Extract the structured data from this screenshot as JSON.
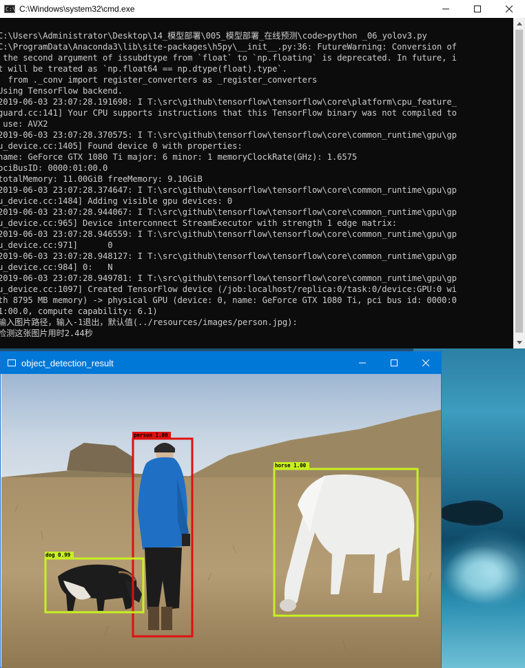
{
  "cmd_window": {
    "title": "C:\\Windows\\system32\\cmd.exe",
    "icon": "C:\\",
    "lines": [
      "C:\\Users\\Administrator\\Desktop\\14_模型部署\\005_模型部署_在线预测\\code>python _06_yolov3.py",
      "C:\\ProgramData\\Anaconda3\\lib\\site-packages\\h5py\\__init__.py:36: FutureWarning: Conversion of",
      " the second argument of issubdtype from `float` to `np.floating` is deprecated. In future, i",
      "t will be treated as `np.float64 == np.dtype(float).type`.",
      "  from ._conv import register_converters as _register_converters",
      "Using TensorFlow backend.",
      "2019-06-03 23:07:28.191698: I T:\\src\\github\\tensorflow\\tensorflow\\core\\platform\\cpu_feature_",
      "guard.cc:141] Your CPU supports instructions that this TensorFlow binary was not compiled to",
      " use: AVX2",
      "2019-06-03 23:07:28.370575: I T:\\src\\github\\tensorflow\\tensorflow\\core\\common_runtime\\gpu\\gp",
      "u_device.cc:1405] Found device 0 with properties:",
      "name: GeForce GTX 1080 Ti major: 6 minor: 1 memoryClockRate(GHz): 1.6575",
      "pciBusID: 0000:01:00.0",
      "totalMemory: 11.00GiB freeMemory: 9.10GiB",
      "2019-06-03 23:07:28.374647: I T:\\src\\github\\tensorflow\\tensorflow\\core\\common_runtime\\gpu\\gp",
      "u_device.cc:1484] Adding visible gpu devices: 0",
      "2019-06-03 23:07:28.944067: I T:\\src\\github\\tensorflow\\tensorflow\\core\\common_runtime\\gpu\\gp",
      "u_device.cc:965] Device interconnect StreamExecutor with strength 1 edge matrix:",
      "2019-06-03 23:07:28.946559: I T:\\src\\github\\tensorflow\\tensorflow\\core\\common_runtime\\gpu\\gp",
      "u_device.cc:971]      0",
      "2019-06-03 23:07:28.948127: I T:\\src\\github\\tensorflow\\tensorflow\\core\\common_runtime\\gpu\\gp",
      "u_device.cc:984] 0:   N",
      "2019-06-03 23:07:28.949781: I T:\\src\\github\\tensorflow\\tensorflow\\core\\common_runtime\\gpu\\gp",
      "u_device.cc:1097] Created TensorFlow device (/job:localhost/replica:0/task:0/device:GPU:0 wi",
      "th 8795 MB memory) -> physical GPU (device: 0, name: GeForce GTX 1080 Ti, pci bus id: 0000:0",
      "1:00.0, compute capability: 6.1)",
      "输入图片路径，输入-1退出，默认值(../resources/images/person.jpg):",
      "检测这张图片用时2.44秒"
    ]
  },
  "viewer_window": {
    "title": "object_detection_result",
    "detections": [
      {
        "label": "person 1.00",
        "color": "#e01010"
      },
      {
        "label": "horse 1.00",
        "color": "#c8f020"
      },
      {
        "label": "dog 0.99",
        "color": "#c8f020"
      }
    ]
  },
  "colors": {
    "titlebar_active": "#0078d7",
    "console_bg": "#0c0c0c",
    "console_text": "#cccccc"
  }
}
